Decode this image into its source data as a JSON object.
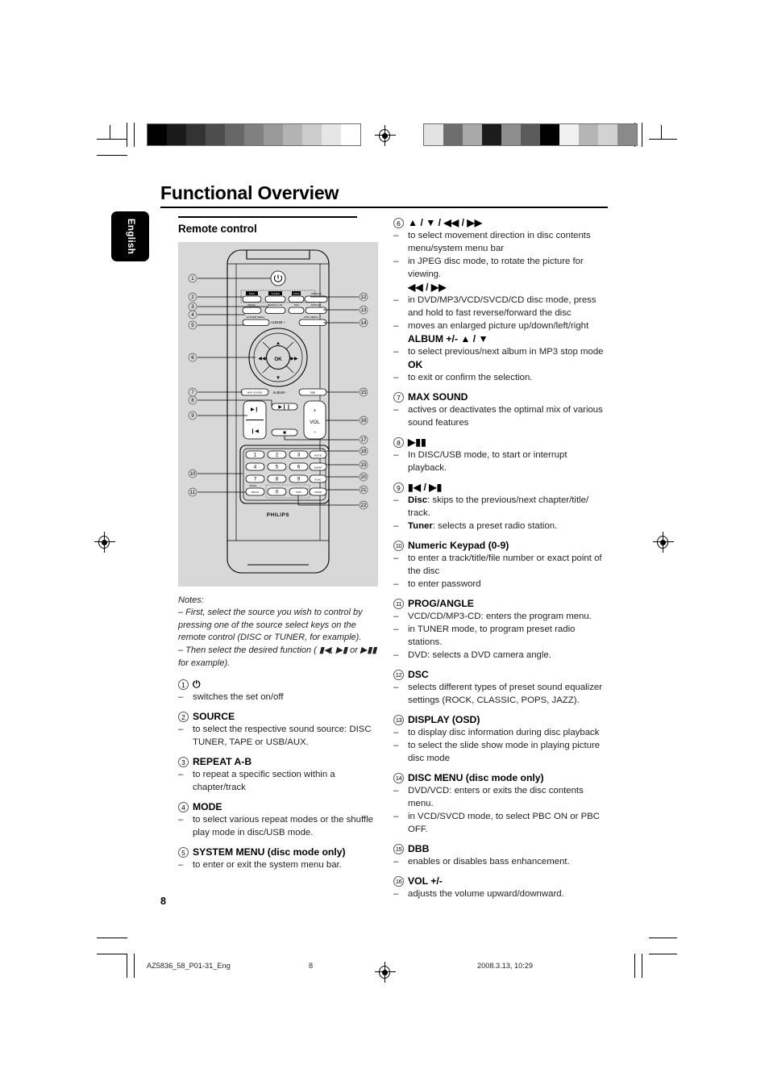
{
  "document": {
    "title": "Functional Overview",
    "language_tab": "English",
    "page_number": "8",
    "footer_file": "AZ5836_58_P01-31_Eng",
    "footer_page": "8",
    "footer_timestamp": "2008.3.13, 10:29"
  },
  "left_column": {
    "section_heading": "Remote control",
    "remote": {
      "brand": "PHILIPS",
      "power_icon": "power-icon",
      "ok_label": "OK",
      "album_plus": "ALBUM +",
      "album_minus": "ALBUM -",
      "vol_label": "VOL",
      "vol_plus": "+",
      "vol_minus": "–",
      "source_buttons": [
        "DISC",
        "TUNER",
        "TAPE",
        "USB/AUX"
      ],
      "function_row1": [
        "MODE",
        "REPEAT A-B",
        "DSC",
        "DISPLAY"
      ],
      "function_row2": [
        "SYSTEM MENU",
        "DISC MENU"
      ],
      "sound_row": [
        "MAX SOUND",
        "DBB"
      ],
      "transport": [
        "▶▮▮",
        "▮◀",
        "▶▮",
        "■"
      ],
      "keypad": [
        "1",
        "2",
        "3",
        "4",
        "5",
        "6",
        "7",
        "8",
        "9",
        "0"
      ],
      "right_keys": [
        "MUTE",
        "SLEEP",
        "SYNC",
        "SURR"
      ],
      "prog_label": "PROG",
      "dvd_key": "DVD",
      "nav_up": "▲",
      "nav_down": "▼",
      "nav_left": "◀◀",
      "nav_right": "▶▶",
      "callouts_left": [
        "1",
        "2",
        "3",
        "4",
        "5",
        "6",
        "7",
        "8",
        "9",
        "10",
        "11"
      ],
      "callouts_right": [
        "12",
        "13",
        "14",
        "15",
        "16",
        "17",
        "18",
        "19",
        "20",
        "21",
        "22"
      ]
    },
    "notes": {
      "heading": "Notes:",
      "items": [
        "–  First, select the source you wish to control by pressing one of the source select keys on the remote control (DISC or TUNER, for example).",
        "–  Then select the desired function ( ▮◀,  ▶▮  or ▶▮▮ for example)."
      ]
    },
    "entries": [
      {
        "num": "1",
        "label": "⏻",
        "label_is_icon": true,
        "bullets": [
          {
            "dash": "–",
            "text": "switches the set on/off"
          }
        ]
      },
      {
        "num": "2",
        "label": "SOURCE",
        "bullets": [
          {
            "dash": "–",
            "text": "to select the respective sound source: DISC TUNER, TAPE or USB/AUX."
          }
        ]
      },
      {
        "num": "3",
        "label": "REPEAT A-B",
        "bullets": [
          {
            "dash": "–",
            "text": "to repeat a specific section within a chapter/track"
          }
        ]
      },
      {
        "num": "4",
        "label": "MODE",
        "bullets": [
          {
            "dash": "–",
            "text": "to select various repeat modes or the shuffle play mode in disc/USB mode."
          }
        ]
      },
      {
        "num": "5",
        "label": "SYSTEM MENU (disc mode only)",
        "bullets": [
          {
            "dash": "–",
            "text": "to enter or exit the system menu bar."
          }
        ]
      }
    ]
  },
  "right_column": {
    "entries": [
      {
        "num": "6",
        "label": "▲ / ▼ / ◀◀ / ▶▶",
        "bullets": [
          {
            "dash": "–",
            "text": "to select movement direction in disc contents menu/system menu bar"
          },
          {
            "dash": "–",
            "text": "in JPEG disc mode, to rotate the picture for viewing."
          }
        ],
        "sublabel1": "◀◀ / ▶▶",
        "bullets2": [
          {
            "dash": "–",
            "text": "in DVD/MP3/VCD/SVCD/CD disc mode, press and hold to fast reverse/forward the disc"
          },
          {
            "dash": "–",
            "text": "moves an enlarged picture up/down/left/right"
          }
        ],
        "sublabel2": "ALBUM +/- ▲ / ▼",
        "bullets3": [
          {
            "dash": "–",
            "text": "to select previous/next album in MP3 stop mode"
          }
        ],
        "sublabel3": "OK",
        "bullets4": [
          {
            "dash": "–",
            "text": "to exit or confirm the selection."
          }
        ]
      },
      {
        "num": "7",
        "label": "MAX SOUND",
        "bullets": [
          {
            "dash": "–",
            "text": "actives or deactivates the optimal mix of various sound features"
          }
        ]
      },
      {
        "num": "8",
        "label": "▶▮▮",
        "bullets": [
          {
            "dash": "–",
            "text": "In DISC/USB mode, to start or interrupt playback."
          }
        ]
      },
      {
        "num": "9",
        "label": "▮◀ / ▶▮",
        "bullets": [
          {
            "dash": "–",
            "bold": "Disc",
            "text": ": skips to the previous/next chapter/title/ track."
          },
          {
            "dash": "–",
            "bold": "Tuner",
            "text": ": selects a preset radio station."
          }
        ]
      },
      {
        "num": "10",
        "label": "Numeric Keypad (0-9)",
        "bullets": [
          {
            "dash": "–",
            "text": "to enter a track/title/file number or exact point of the disc"
          },
          {
            "dash": "–",
            "text": "to enter password"
          }
        ]
      },
      {
        "num": "11",
        "label": "PROG/ANGLE",
        "bullets": [
          {
            "dash": "–",
            "text": "VCD/CD/MP3-CD: enters the program menu."
          },
          {
            "dash": "–",
            "text": "in TUNER mode, to program preset radio stations."
          },
          {
            "dash": "–",
            "text": "DVD: selects a DVD camera angle."
          }
        ]
      },
      {
        "num": "12",
        "label": "DSC",
        "bullets": [
          {
            "dash": "–",
            "text": "selects different types of preset sound equalizer settings (ROCK, CLASSIC, POPS, JAZZ)."
          }
        ]
      },
      {
        "num": "13",
        "label": "DISPLAY (OSD)",
        "bullets": [
          {
            "dash": "–",
            "text": "to display disc information during disc playback"
          },
          {
            "dash": "–",
            "text": "to select the slide show mode in playing picture disc mode"
          }
        ]
      },
      {
        "num": "14",
        "label": "DISC MENU (disc mode only)",
        "bullets": [
          {
            "dash": "–",
            "text": "DVD/VCD: enters or exits the disc contents menu."
          },
          {
            "dash": "–",
            "text": "in VCD/SVCD mode, to select PBC ON or PBC OFF."
          }
        ]
      },
      {
        "num": "15",
        "label": "DBB",
        "bullets": [
          {
            "dash": "–",
            "text": "enables or disables bass enhancement."
          }
        ]
      },
      {
        "num": "16",
        "label": "VOL +/-",
        "bullets": [
          {
            "dash": "–",
            "text": "adjusts the volume upward/downward."
          }
        ]
      }
    ]
  },
  "calibration": {
    "left_bar": [
      "#000000",
      "#1a1a1a",
      "#333333",
      "#4d4d4d",
      "#666666",
      "#808080",
      "#999999",
      "#b3b3b3",
      "#cccccc",
      "#e6e6e6",
      "#ffffff"
    ],
    "right_bar": [
      "#e3e3e3",
      "#6e6e6e",
      "#a9a9a9",
      "#1c1c1c",
      "#8e8e8e",
      "#5a5a5a",
      "#000000",
      "#f0f0f0",
      "#b5b5b5",
      "#d2d2d2",
      "#8a8a8a"
    ]
  }
}
